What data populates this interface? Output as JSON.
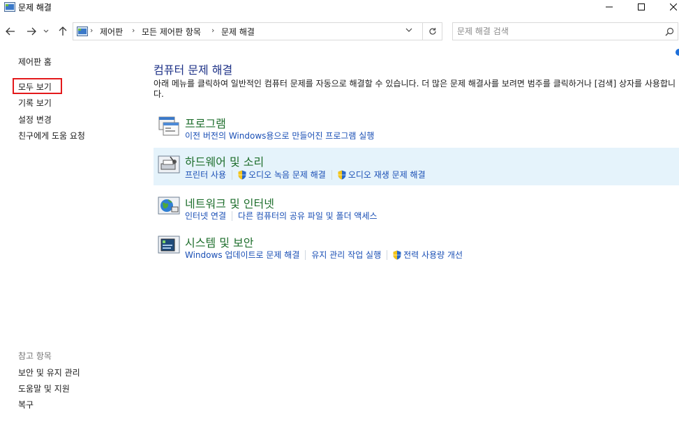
{
  "window": {
    "title": "문제 해결"
  },
  "address": {
    "crumbs": [
      "제어판",
      "모든 제어판 항목",
      "문제 해결"
    ]
  },
  "search": {
    "placeholder": "문제 해결 검색"
  },
  "sidebar": {
    "home": "제어판 홈",
    "items": [
      "모두 보기",
      "기록 보기",
      "설정 변경",
      "친구에게 도움 요청"
    ],
    "see_also_label": "참고 항목",
    "see_also": [
      "보안 및 유지 관리",
      "도움말 및 지원",
      "복구"
    ]
  },
  "main": {
    "title": "컴퓨터 문제 해결",
    "description": "아래 메뉴를 클릭하여 일반적인 컴퓨터 문제를 자동으로 해결할 수 있습니다. 더 많은 문제 해결사를 보려면 범주를 클릭하거나 [검색] 상자를 사용합니다.",
    "categories": [
      {
        "title": "프로그램",
        "icon": "programs-icon",
        "links": [
          "이전 버전의 Windows용으로 만들어진 프로그램 실행"
        ]
      },
      {
        "title": "하드웨어 및 소리",
        "icon": "hardware-sound-icon",
        "links": [
          "프린터 사용",
          "오디오 녹음 문제 해결",
          "오디오 재생 문제 해결"
        ]
      },
      {
        "title": "네트워크 및 인터넷",
        "icon": "network-internet-icon",
        "links": [
          "인터넷 연결",
          "다른 컴퓨터의 공유 파일 및 폴더 액세스"
        ]
      },
      {
        "title": "시스템 및 보안",
        "icon": "system-security-icon",
        "links": [
          "Windows 업데이트로 문제 해결",
          "유지 관리 작업 실행",
          "전력 사용량 개선"
        ]
      }
    ]
  },
  "colors": {
    "category_title": "#1e6e2c",
    "link": "#1a4fb5",
    "heading": "#1e3287",
    "highlight_row": "#e5f3fb",
    "selection_border": "#e3191b"
  }
}
